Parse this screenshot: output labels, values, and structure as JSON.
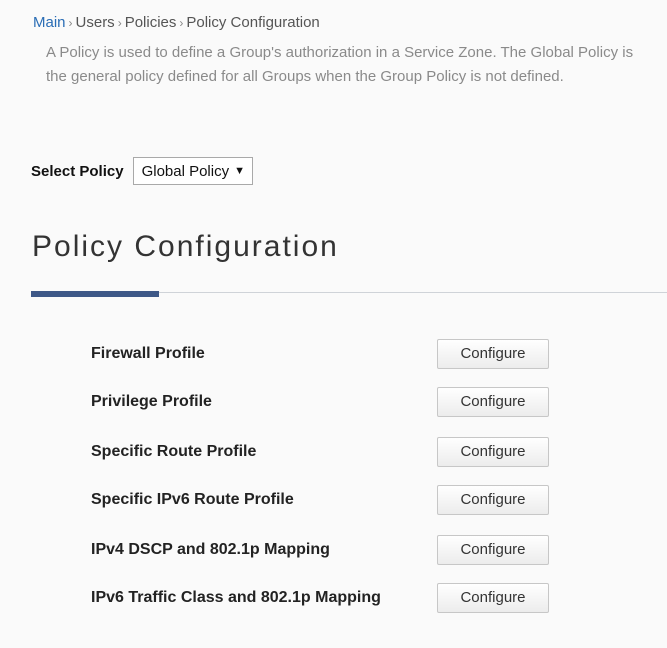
{
  "breadcrumb": {
    "items": [
      "Main",
      "Users",
      "Policies",
      "Policy Configuration"
    ],
    "separator": "›"
  },
  "description": "A Policy is used to define a Group's authorization in a Service Zone. The Global Policy is the general policy defined for all Groups when the Group Policy is not defined.",
  "select_policy": {
    "label": "Select Policy",
    "value": "Global Policy",
    "arrow": "▼"
  },
  "page_title": "Policy Configuration",
  "colors": {
    "link": "#2a6db5",
    "accent_bar": "#3e5887"
  },
  "profiles": [
    {
      "label": "Firewall Profile",
      "button": "Configure"
    },
    {
      "label": "Privilege Profile",
      "button": "Configure"
    },
    {
      "label": "Specific Route Profile",
      "button": "Configure"
    },
    {
      "label": "Specific IPv6 Route Profile",
      "button": "Configure"
    },
    {
      "label": "IPv4 DSCP and 802.1p Mapping",
      "button": "Configure"
    },
    {
      "label": "IPv6 Traffic Class and 802.1p Mapping",
      "button": "Configure"
    }
  ]
}
